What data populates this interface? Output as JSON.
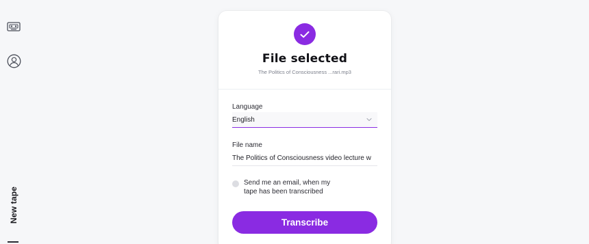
{
  "sidebar": {
    "icons": [
      "tape-icon",
      "user-icon"
    ],
    "new_tape_label": "New tape"
  },
  "card": {
    "title": "File selected",
    "file_subtitle": "The Politics of Consciousness ...rari.mp3",
    "language": {
      "label": "Language",
      "value": "English"
    },
    "file_name": {
      "label": "File name",
      "value": "The Politics of Consciousness  video lecture w"
    },
    "email_option": {
      "line1": "Send me an email, when my",
      "line2": "tape has been transcribed",
      "checked": false
    },
    "submit_label": "Transcribe"
  },
  "colors": {
    "accent": "#8a2be2",
    "background": "#f6f7f9",
    "card": "#ffffff"
  }
}
